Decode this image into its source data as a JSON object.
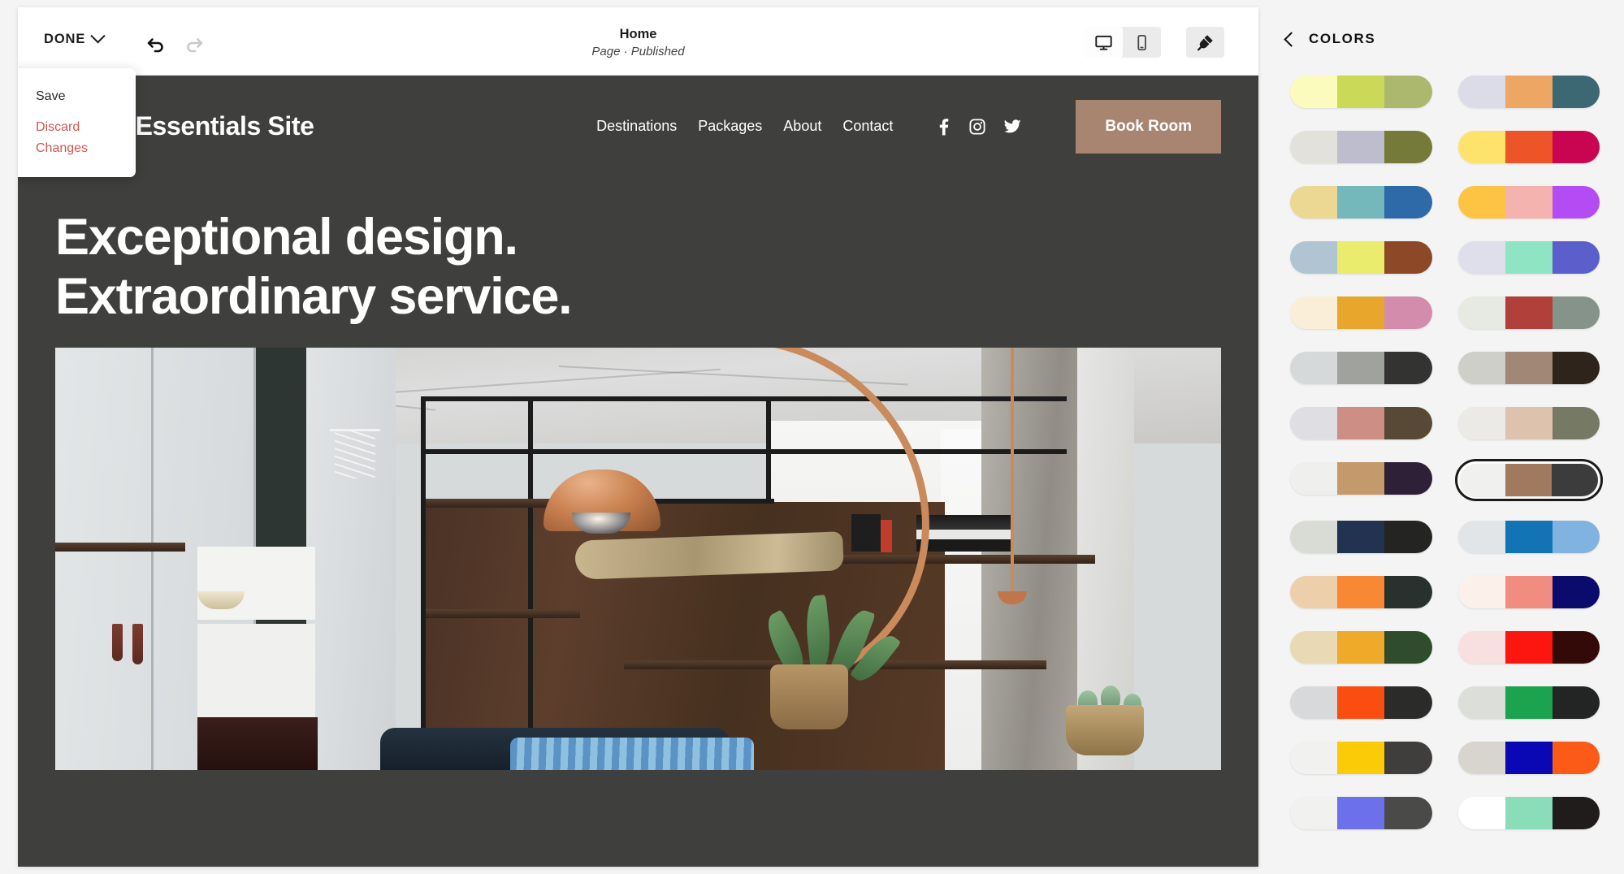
{
  "editor": {
    "toolbar": {
      "done_label": "DONE",
      "undo_icon": "undo-arrow-icon",
      "redo_icon": "redo-arrow-icon",
      "page_title": "Home",
      "page_status": "Page · Published",
      "desktop_icon": "desktop-monitor-icon",
      "mobile_icon": "mobile-phone-icon",
      "theme_icon": "paintbrush-icon",
      "active_device": "desktop"
    },
    "done_menu": {
      "items": [
        {
          "label": "Save",
          "style": "default"
        },
        {
          "label": "Discard Changes",
          "style": "danger"
        }
      ]
    }
  },
  "site": {
    "logo": "Travel Essentials Site",
    "nav": [
      {
        "label": "Destinations"
      },
      {
        "label": "Packages"
      },
      {
        "label": "About"
      },
      {
        "label": "Contact"
      }
    ],
    "social": [
      {
        "name": "facebook-icon"
      },
      {
        "name": "instagram-icon"
      },
      {
        "name": "twitter-icon"
      }
    ],
    "cta_label": "Book Room",
    "hero": {
      "line1": "Exceptional design.",
      "line2": "Extraordinary service."
    },
    "colors": {
      "background": "#3f3f3d",
      "cta_background": "#a88571",
      "text": "#ffffff"
    }
  },
  "colors_panel": {
    "back_icon": "chevron-left-icon",
    "title": "COLORS",
    "selected_index": 15,
    "swatches": [
      {
        "colors": [
          "#fbfbbd",
          "#cada58",
          "#acb86d"
        ]
      },
      {
        "colors": [
          "#dcdce8",
          "#eda663",
          "#3b6873"
        ]
      },
      {
        "colors": [
          "#e3e1dc",
          "#bdbdcd",
          "#767a39"
        ]
      },
      {
        "colors": [
          "#fde36b",
          "#ed5529",
          "#c90551"
        ]
      },
      {
        "colors": [
          "#ecd893",
          "#74b8bb",
          "#2e6aa8"
        ]
      },
      {
        "colors": [
          "#fdc444",
          "#f4b3ae",
          "#b44cf4"
        ]
      },
      {
        "colors": [
          "#b1c4d2",
          "#e9ec6d",
          "#8c4827"
        ]
      },
      {
        "colors": [
          "#dfdeeb",
          "#8fe5c3",
          "#5a5fcc"
        ]
      },
      {
        "colors": [
          "#fbeed9",
          "#e8a62c",
          "#d38cab"
        ]
      },
      {
        "colors": [
          "#e7e9e3",
          "#b04039",
          "#85938a"
        ]
      },
      {
        "colors": [
          "#d6d9da",
          "#a0a29e",
          "#333332"
        ]
      },
      {
        "colors": [
          "#cfcfc9",
          "#a08776",
          "#2e241b"
        ]
      },
      {
        "colors": [
          "#dedee3",
          "#cd8e85",
          "#584936"
        ]
      },
      {
        "colors": [
          "#eceae6",
          "#ddc3ae",
          "#767a64"
        ]
      },
      {
        "colors": [
          "#eff0ee",
          "#c49a6c",
          "#2d2037"
        ]
      },
      {
        "colors": [
          "#f0f0ee",
          "#a0795f",
          "#3c3c3c"
        ]
      },
      {
        "colors": [
          "#d9dcd4",
          "#213351",
          "#242423"
        ]
      },
      {
        "colors": [
          "#e2e5e8",
          "#1274b5",
          "#81b3e0"
        ]
      },
      {
        "colors": [
          "#edd0ab",
          "#f98834",
          "#29312f"
        ]
      },
      {
        "colors": [
          "#fcf1ea",
          "#f18d80",
          "#0b0b6e"
        ]
      },
      {
        "colors": [
          "#e9d9b4",
          "#eeaa28",
          "#2f4c2d"
        ]
      },
      {
        "colors": [
          "#f8dfe0",
          "#fb1710",
          "#330a07"
        ]
      },
      {
        "colors": [
          "#d7d9da",
          "#fa4e11",
          "#2b2b2a"
        ]
      },
      {
        "colors": [
          "#dcdfd9",
          "#1ba34e",
          "#232424"
        ]
      },
      {
        "colors": [
          "#f1f1ef",
          "#fccb08",
          "#3f3e3d"
        ]
      },
      {
        "colors": [
          "#d7d5ce",
          "#0a08b5",
          "#fb5a17"
        ]
      },
      {
        "colors": [
          "#f1f1f0",
          "#6c70ea",
          "#4a4a49"
        ]
      },
      {
        "colors": [
          "#ffffff",
          "#8bdcb9",
          "#201c1b"
        ]
      }
    ]
  }
}
